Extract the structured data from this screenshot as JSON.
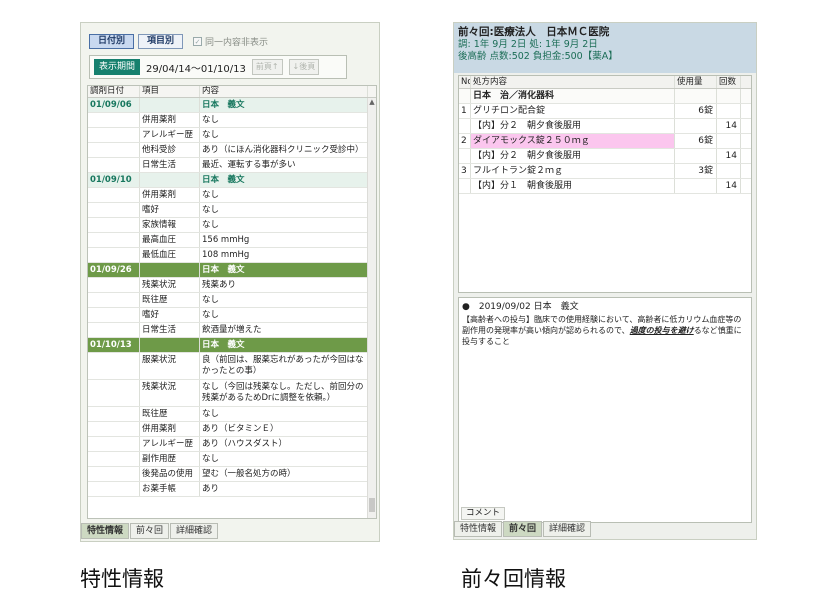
{
  "left": {
    "tabs": [
      "日付別",
      "項目別"
    ],
    "checkbox_label": "同一内容非表示",
    "period_button": "表示期間",
    "period_text": "29/04/14〜01/10/13",
    "prev_button": "前頁↑",
    "next_button": "↓後頁",
    "columns": [
      "調剤日付",
      "項目",
      "内容"
    ],
    "rows": [
      {
        "type": "date1",
        "date": "01/09/06",
        "item": "",
        "content": "日本　義文"
      },
      {
        "type": "row",
        "date": "",
        "item": "併用薬剤",
        "content": "なし"
      },
      {
        "type": "row",
        "date": "",
        "item": "アレルギー歴",
        "content": "なし"
      },
      {
        "type": "row",
        "date": "",
        "item": "他科受診",
        "content": "あり（にほん消化器科クリニック受診中）"
      },
      {
        "type": "row",
        "date": "",
        "item": "日常生活",
        "content": "最近、運転する事が多い"
      },
      {
        "type": "date1",
        "date": "01/09/10",
        "item": "",
        "content": "日本　義文"
      },
      {
        "type": "row",
        "date": "",
        "item": "併用薬剤",
        "content": "なし"
      },
      {
        "type": "row",
        "date": "",
        "item": "嗜好",
        "content": "なし"
      },
      {
        "type": "row",
        "date": "",
        "item": "家族情報",
        "content": "なし"
      },
      {
        "type": "row",
        "date": "",
        "item": "最高血圧",
        "content": "156 mmHg"
      },
      {
        "type": "row",
        "date": "",
        "item": "最低血圧",
        "content": "108 mmHg"
      },
      {
        "type": "date2",
        "date": "01/09/26",
        "item": "",
        "content": "日本　義文"
      },
      {
        "type": "row",
        "date": "",
        "item": "残薬状況",
        "content": "残薬あり"
      },
      {
        "type": "row",
        "date": "",
        "item": "既往歴",
        "content": "なし"
      },
      {
        "type": "row",
        "date": "",
        "item": "嗜好",
        "content": "なし"
      },
      {
        "type": "row",
        "date": "",
        "item": "日常生活",
        "content": "飲酒量が増えた"
      },
      {
        "type": "date2",
        "date": "01/10/13",
        "item": "",
        "content": "日本　義文"
      },
      {
        "type": "wrap",
        "date": "",
        "item": "服薬状況",
        "content": "良（前回は、服薬忘れがあったが今回はなかったとの事）"
      },
      {
        "type": "wrap",
        "date": "",
        "item": "残薬状況",
        "content": "なし（今回は残薬なし。ただし、前回分の残薬があるためDrに調整を依頼。）"
      },
      {
        "type": "row",
        "date": "",
        "item": "既往歴",
        "content": "なし"
      },
      {
        "type": "row",
        "date": "",
        "item": "併用薬剤",
        "content": "あり（ビタミンＥ）"
      },
      {
        "type": "row",
        "date": "",
        "item": "アレルギー歴",
        "content": "あり（ハウスダスト）"
      },
      {
        "type": "row",
        "date": "",
        "item": "副作用歴",
        "content": "なし"
      },
      {
        "type": "row",
        "date": "",
        "item": "後発品の使用",
        "content": "望む（一般名処方の時）"
      },
      {
        "type": "row",
        "date": "",
        "item": "お薬手帳",
        "content": "あり"
      }
    ],
    "bottom_tabs": [
      "特性情報",
      "前々回",
      "詳細確認"
    ]
  },
  "right": {
    "title": "前々回:医療法人　日本ＭＣ医院",
    "sub1": "調: 1年 9月 2日 処: 1年 9月 2日",
    "sub2": "後高齢 点数:502 負担金:500【薬A】",
    "columns": [
      "No",
      "処方内容",
      "使用量",
      "回数"
    ],
    "group": "日本　治／消化器科",
    "meds": [
      {
        "no": "1",
        "name": "グリチロン配合錠",
        "qty": "6錠",
        "usage": "【内】分２　朝夕食後服用",
        "times": "14",
        "highlight": false
      },
      {
        "no": "2",
        "name": "ダイアモックス錠２５０ｍｇ",
        "qty": "6錠",
        "usage": "【内】分２　朝夕食後服用",
        "times": "14",
        "highlight": true
      },
      {
        "no": "3",
        "name": "フルイトラン錠２ｍｇ",
        "qty": "3錠",
        "usage": "【内】分１　朝食後服用",
        "times": "14",
        "highlight": false
      }
    ],
    "note_header": "●　2019/09/02  日本　義文",
    "note_body_1": "【高齢者への投与】臨床での使用経験において、高齢者に低カリウム血症等の副作用の発現率が高い傾向が認められるので、",
    "note_body_em": "過度の投与を避け",
    "note_body_2": "るなど",
    "note_body_3": "慎重に投与すること",
    "comment_tab": "コメント",
    "bottom_tabs": [
      "特性情報",
      "前々回",
      "詳細確認"
    ]
  },
  "captions": {
    "left": "特性情報",
    "right": "前々回情報"
  }
}
